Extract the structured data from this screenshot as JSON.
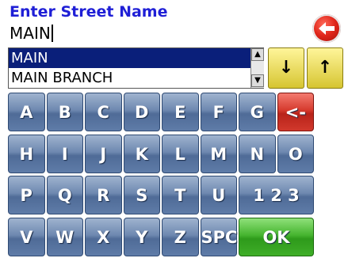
{
  "prompt": "Enter Street Name",
  "input": {
    "value": "MAIN"
  },
  "suggestions": [
    {
      "label": "MAIN",
      "selected": true
    },
    {
      "label": "MAIN BRANCH",
      "selected": false
    }
  ],
  "nav": {
    "down": "↓",
    "up": "↑"
  },
  "back_icon": "back-arrow-icon",
  "keyboard": {
    "rows": [
      [
        "A",
        "B",
        "C",
        "D",
        "E",
        "F",
        "G",
        "<-"
      ],
      [
        "H",
        "I",
        "J",
        "K",
        "L",
        "M",
        "N",
        "O"
      ],
      [
        "P",
        "Q",
        "R",
        "S",
        "T",
        "U",
        "1 2 3"
      ],
      [
        "V",
        "W",
        "X",
        "Y",
        "Z",
        "SPC",
        "OK"
      ]
    ]
  },
  "colors": {
    "prompt": "#1f1fd6",
    "selection": "#0a1f7a",
    "key": "#5f7ca8",
    "backspace": "#d63b2e",
    "ok": "#3fae28"
  }
}
